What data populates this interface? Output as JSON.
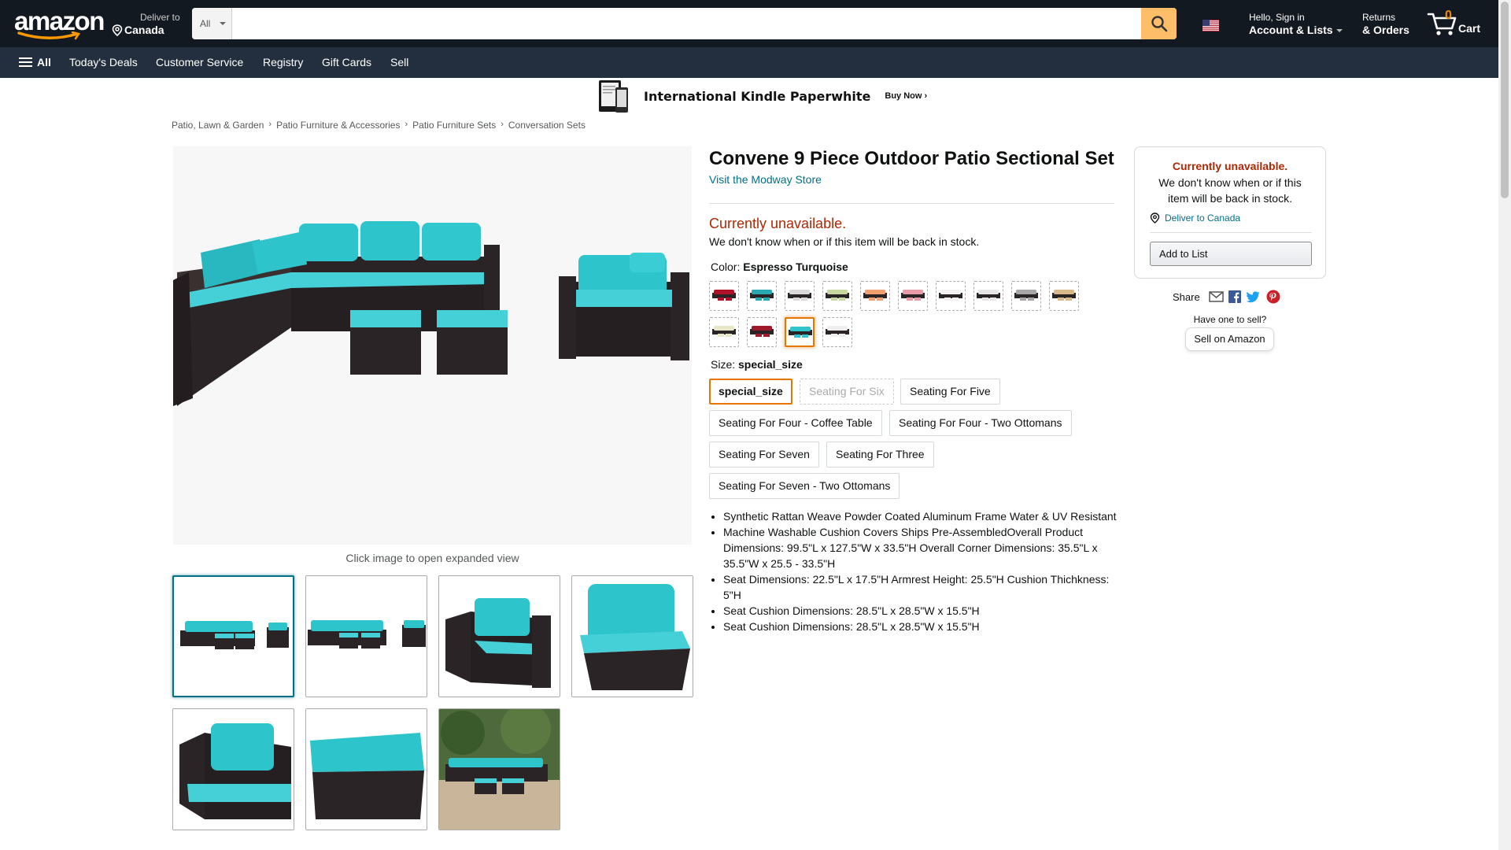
{
  "nav": {
    "logo_text": "amazon",
    "deliver_line1": "Deliver to",
    "deliver_line2": "Canada",
    "search_category": "All",
    "search_placeholder": "",
    "account_line1": "Hello, Sign in",
    "account_line2": "Account & Lists",
    "returns_line1": "Returns",
    "returns_line2": "& Orders",
    "cart_count": "0",
    "cart_label": "Cart"
  },
  "subnav": {
    "all_label": "All",
    "links": [
      "Today's Deals",
      "Customer Service",
      "Registry",
      "Gift Cards",
      "Sell"
    ]
  },
  "banner": {
    "title": "International Kindle Paperwhite",
    "cta": "Buy Now ›"
  },
  "breadcrumb": [
    "Patio, Lawn & Garden",
    "Patio Furniture & Accessories",
    "Patio Furniture Sets",
    "Conversation Sets"
  ],
  "gallery": {
    "hint": "Click image to open expanded view",
    "selected_index": 0
  },
  "product": {
    "title": "Convene 9 Piece Outdoor Patio Sectional Set",
    "store_link": "Visit the Modway Store",
    "availability": "Currently unavailable.",
    "availability_note": "We don't know when or if this item will be back in stock.",
    "color_label": "Color:",
    "color_value": "Espresso Turquoise",
    "swatch_colors": [
      "#b0102a",
      "#2aa8b0",
      "#d9d9d9",
      "#c8d6a0",
      "#f0a070",
      "#e89aa8",
      "#f2f2f2",
      "#e6e6e6",
      "#a6a6a6",
      "#d9b98a",
      "#e6e8c8",
      "#9e1a2a",
      "#2ec4cc",
      "#eeeeee"
    ],
    "swatch_selected": 12,
    "size_label": "Size:",
    "size_value": "special_size",
    "sizes": [
      "special_size",
      "Seating For Six",
      "Seating For Five",
      "Seating For Four - Coffee Table",
      "Seating For Four - Two Ottomans",
      "Seating For Seven",
      "Seating For Three",
      "Seating For Seven - Two Ottomans"
    ],
    "bullets": [
      "Synthetic Rattan Weave Powder Coated Aluminum Frame Water & UV Resistant",
      "Machine Washable Cushion Covers Ships Pre-AssembledOverall Product Dimensions: 99.5\"L x 127.5\"W x 33.5\"H Overall Corner Dimensions: 35.5\"L x 35.5\"W x 25.5 - 33.5\"H",
      "Seat Dimensions: 22.5\"L x 17.5\"H Armrest Height: 25.5\"H Cushion Thichkness: 5\"H",
      "Seat Cushion Dimensions: 28.5\"L x 28.5\"W x 15.5\"H",
      "Seat Cushion Dimensions: 28.5\"L x 28.5\"W x 15.5\"H"
    ]
  },
  "buybox": {
    "status": "Currently unavailable.",
    "note": "We don't know when or if this item will be back in stock.",
    "deliver_link": "Deliver to Canada",
    "add_to_list": "Add to List",
    "share_label": "Share",
    "have_one": "Have one to sell?",
    "sell_button": "Sell on Amazon"
  },
  "colors": {
    "nav_bg": "#131921",
    "subnav_bg": "#232f3e",
    "search_button": "#febd69",
    "link": "#007185",
    "unavailable": "#b12704",
    "selected_outline": "#e77600",
    "cushion_turquoise": "#2ec4cc",
    "wicker_espresso": "#2b2426"
  }
}
